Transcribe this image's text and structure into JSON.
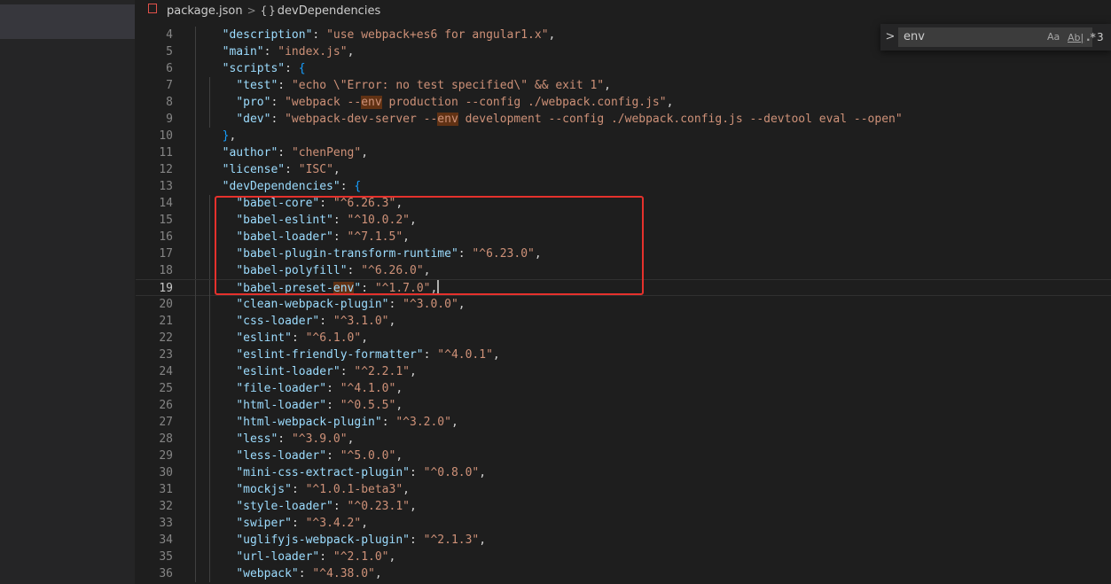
{
  "breadcrumb": {
    "file": "package.json",
    "file_icon": "json-file-icon",
    "separator": ">",
    "symbol_icon": "{ }",
    "symbol": "devDependencies"
  },
  "find": {
    "toggle": ">",
    "query": "env",
    "case_label": "Aa",
    "word_label": "Ab|",
    "regex_label": ".*",
    "count": "3"
  },
  "colors": {
    "key": "#9cdcfe",
    "string": "#ce9178",
    "match_highlight": "#613214",
    "annotation_box": "#e5312c"
  },
  "lines": [
    {
      "n": "4",
      "indent": 1,
      "tokens": [
        [
          "k",
          "\"description\""
        ],
        [
          "p",
          ": "
        ],
        [
          "s",
          "\"use webpack+es6 for angular1.x\""
        ],
        [
          "p",
          ","
        ]
      ]
    },
    {
      "n": "5",
      "indent": 1,
      "tokens": [
        [
          "k",
          "\"main\""
        ],
        [
          "p",
          ": "
        ],
        [
          "s",
          "\"index.js\""
        ],
        [
          "p",
          ","
        ]
      ]
    },
    {
      "n": "6",
      "indent": 1,
      "tokens": [
        [
          "k",
          "\"scripts\""
        ],
        [
          "p",
          ": "
        ],
        [
          "b2",
          "{"
        ]
      ]
    },
    {
      "n": "7",
      "indent": 2,
      "tokens": [
        [
          "k",
          "\"test\""
        ],
        [
          "p",
          ": "
        ],
        [
          "s",
          "\"echo \\\"Error: no test specified\\\" && exit 1\""
        ],
        [
          "p",
          ","
        ]
      ]
    },
    {
      "n": "8",
      "indent": 2,
      "tokens": [
        [
          "k",
          "\"pro\""
        ],
        [
          "p",
          ": "
        ],
        [
          "s",
          "\"webpack --"
        ],
        [
          "sm",
          "env"
        ],
        [
          "s",
          " production --config ./webpack.config.js\""
        ],
        [
          "p",
          ","
        ]
      ]
    },
    {
      "n": "9",
      "indent": 2,
      "tokens": [
        [
          "k",
          "\"dev\""
        ],
        [
          "p",
          ": "
        ],
        [
          "s",
          "\"webpack-dev-server --"
        ],
        [
          "sm",
          "env"
        ],
        [
          "s",
          " development --config ./webpack.config.js --devtool eval --open\""
        ]
      ]
    },
    {
      "n": "10",
      "indent": 1,
      "tokens": [
        [
          "b2",
          "}"
        ],
        [
          "p",
          ","
        ]
      ]
    },
    {
      "n": "11",
      "indent": 1,
      "tokens": [
        [
          "k",
          "\"author\""
        ],
        [
          "p",
          ": "
        ],
        [
          "s",
          "\"chenPeng\""
        ],
        [
          "p",
          ","
        ]
      ]
    },
    {
      "n": "12",
      "indent": 1,
      "tokens": [
        [
          "k",
          "\"license\""
        ],
        [
          "p",
          ": "
        ],
        [
          "s",
          "\"ISC\""
        ],
        [
          "p",
          ","
        ]
      ]
    },
    {
      "n": "13",
      "indent": 1,
      "tokens": [
        [
          "k",
          "\"devDependencies\""
        ],
        [
          "p",
          ": "
        ],
        [
          "b2",
          "{"
        ]
      ]
    },
    {
      "n": "14",
      "indent": 2,
      "tokens": [
        [
          "k",
          "\"babel-core\""
        ],
        [
          "p",
          ": "
        ],
        [
          "s",
          "\"^6.26.3\""
        ],
        [
          "p",
          ","
        ]
      ]
    },
    {
      "n": "15",
      "indent": 2,
      "tokens": [
        [
          "k",
          "\"babel-eslint\""
        ],
        [
          "p",
          ": "
        ],
        [
          "s",
          "\"^10.0.2\""
        ],
        [
          "p",
          ","
        ]
      ]
    },
    {
      "n": "16",
      "indent": 2,
      "tokens": [
        [
          "k",
          "\"babel-loader\""
        ],
        [
          "p",
          ": "
        ],
        [
          "s",
          "\"^7.1.5\""
        ],
        [
          "p",
          ","
        ]
      ]
    },
    {
      "n": "17",
      "indent": 2,
      "tokens": [
        [
          "k",
          "\"babel-plugin-transform-runtime\""
        ],
        [
          "p",
          ": "
        ],
        [
          "s",
          "\"^6.23.0\""
        ],
        [
          "p",
          ","
        ]
      ]
    },
    {
      "n": "18",
      "indent": 2,
      "tokens": [
        [
          "k",
          "\"babel-polyfill\""
        ],
        [
          "p",
          ": "
        ],
        [
          "s",
          "\"^6.26.0\""
        ],
        [
          "p",
          ","
        ]
      ]
    },
    {
      "n": "19",
      "indent": 2,
      "current": true,
      "tokens": [
        [
          "k",
          "\"babel-preset-"
        ],
        [
          "km",
          "env"
        ],
        [
          "k",
          "\""
        ],
        [
          "p",
          ": "
        ],
        [
          "s",
          "\"^1.7.0\""
        ],
        [
          "p",
          ","
        ],
        [
          "c",
          ""
        ]
      ]
    },
    {
      "n": "20",
      "indent": 2,
      "tokens": [
        [
          "k",
          "\"clean-webpack-plugin\""
        ],
        [
          "p",
          ": "
        ],
        [
          "s",
          "\"^3.0.0\""
        ],
        [
          "p",
          ","
        ]
      ]
    },
    {
      "n": "21",
      "indent": 2,
      "tokens": [
        [
          "k",
          "\"css-loader\""
        ],
        [
          "p",
          ": "
        ],
        [
          "s",
          "\"^3.1.0\""
        ],
        [
          "p",
          ","
        ]
      ]
    },
    {
      "n": "22",
      "indent": 2,
      "tokens": [
        [
          "k",
          "\"eslint\""
        ],
        [
          "p",
          ": "
        ],
        [
          "s",
          "\"^6.1.0\""
        ],
        [
          "p",
          ","
        ]
      ]
    },
    {
      "n": "23",
      "indent": 2,
      "tokens": [
        [
          "k",
          "\"eslint-friendly-formatter\""
        ],
        [
          "p",
          ": "
        ],
        [
          "s",
          "\"^4.0.1\""
        ],
        [
          "p",
          ","
        ]
      ]
    },
    {
      "n": "24",
      "indent": 2,
      "tokens": [
        [
          "k",
          "\"eslint-loader\""
        ],
        [
          "p",
          ": "
        ],
        [
          "s",
          "\"^2.2.1\""
        ],
        [
          "p",
          ","
        ]
      ]
    },
    {
      "n": "25",
      "indent": 2,
      "tokens": [
        [
          "k",
          "\"file-loader\""
        ],
        [
          "p",
          ": "
        ],
        [
          "s",
          "\"^4.1.0\""
        ],
        [
          "p",
          ","
        ]
      ]
    },
    {
      "n": "26",
      "indent": 2,
      "tokens": [
        [
          "k",
          "\"html-loader\""
        ],
        [
          "p",
          ": "
        ],
        [
          "s",
          "\"^0.5.5\""
        ],
        [
          "p",
          ","
        ]
      ]
    },
    {
      "n": "27",
      "indent": 2,
      "tokens": [
        [
          "k",
          "\"html-webpack-plugin\""
        ],
        [
          "p",
          ": "
        ],
        [
          "s",
          "\"^3.2.0\""
        ],
        [
          "p",
          ","
        ]
      ]
    },
    {
      "n": "28",
      "indent": 2,
      "tokens": [
        [
          "k",
          "\"less\""
        ],
        [
          "p",
          ": "
        ],
        [
          "s",
          "\"^3.9.0\""
        ],
        [
          "p",
          ","
        ]
      ]
    },
    {
      "n": "29",
      "indent": 2,
      "tokens": [
        [
          "k",
          "\"less-loader\""
        ],
        [
          "p",
          ": "
        ],
        [
          "s",
          "\"^5.0.0\""
        ],
        [
          "p",
          ","
        ]
      ]
    },
    {
      "n": "30",
      "indent": 2,
      "tokens": [
        [
          "k",
          "\"mini-css-extract-plugin\""
        ],
        [
          "p",
          ": "
        ],
        [
          "s",
          "\"^0.8.0\""
        ],
        [
          "p",
          ","
        ]
      ]
    },
    {
      "n": "31",
      "indent": 2,
      "tokens": [
        [
          "k",
          "\"mockjs\""
        ],
        [
          "p",
          ": "
        ],
        [
          "s",
          "\"^1.0.1-beta3\""
        ],
        [
          "p",
          ","
        ]
      ]
    },
    {
      "n": "32",
      "indent": 2,
      "tokens": [
        [
          "k",
          "\"style-loader\""
        ],
        [
          "p",
          ": "
        ],
        [
          "s",
          "\"^0.23.1\""
        ],
        [
          "p",
          ","
        ]
      ]
    },
    {
      "n": "33",
      "indent": 2,
      "tokens": [
        [
          "k",
          "\"swiper\""
        ],
        [
          "p",
          ": "
        ],
        [
          "s",
          "\"^3.4.2\""
        ],
        [
          "p",
          ","
        ]
      ]
    },
    {
      "n": "34",
      "indent": 2,
      "tokens": [
        [
          "k",
          "\"uglifyjs-webpack-plugin\""
        ],
        [
          "p",
          ": "
        ],
        [
          "s",
          "\"^2.1.3\""
        ],
        [
          "p",
          ","
        ]
      ]
    },
    {
      "n": "35",
      "indent": 2,
      "tokens": [
        [
          "k",
          "\"url-loader\""
        ],
        [
          "p",
          ": "
        ],
        [
          "s",
          "\"^2.1.0\""
        ],
        [
          "p",
          ","
        ]
      ]
    },
    {
      "n": "36",
      "indent": 2,
      "tokens": [
        [
          "k",
          "\"webpack\""
        ],
        [
          "p",
          ": "
        ],
        [
          "s",
          "\"^4.38.0\""
        ],
        [
          "p",
          ","
        ]
      ]
    }
  ]
}
